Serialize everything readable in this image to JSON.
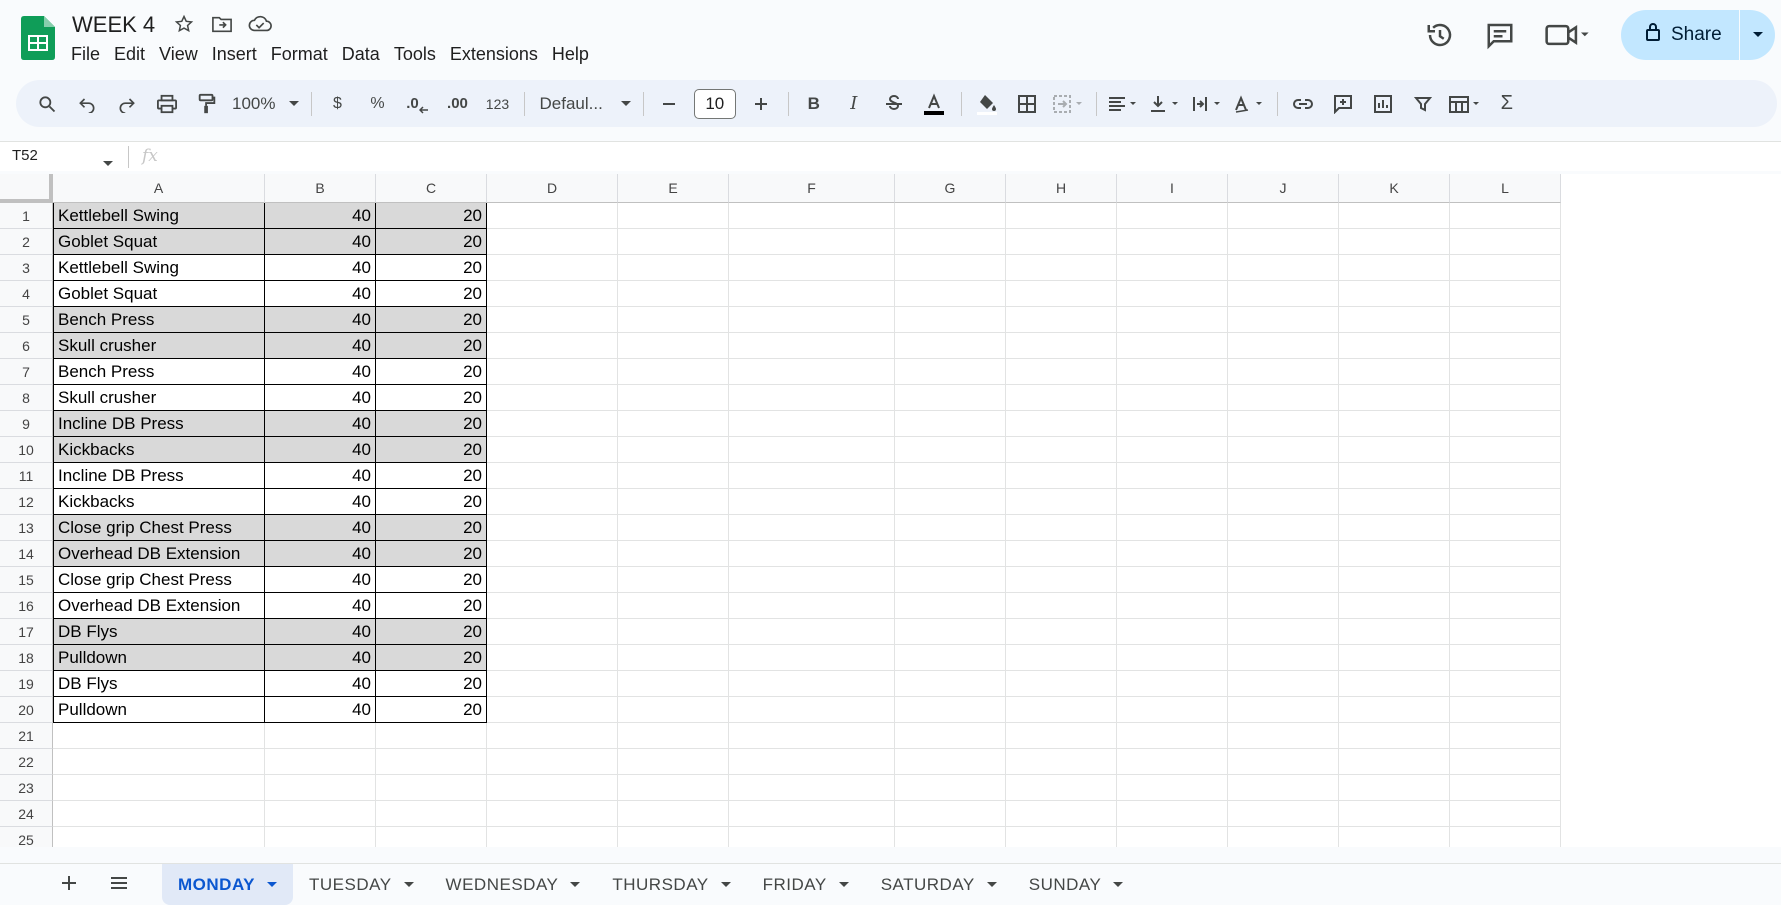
{
  "doc": {
    "title": "WEEK 4"
  },
  "menu": [
    "File",
    "Edit",
    "View",
    "Insert",
    "Format",
    "Data",
    "Tools",
    "Extensions",
    "Help"
  ],
  "share": {
    "label": "Share"
  },
  "toolbar": {
    "zoom": "100%",
    "currency": "$",
    "percent": "%",
    "dec_decrease": ".0",
    "dec_increase": ".00",
    "number_format": "123",
    "font": "Defaul...",
    "font_size": "10"
  },
  "namebox": {
    "value": "T52"
  },
  "formula": {
    "fx": "fx",
    "value": ""
  },
  "columns": [
    "A",
    "B",
    "C",
    "D",
    "E",
    "F",
    "G",
    "H",
    "I",
    "J",
    "K",
    "L"
  ],
  "rows": [
    {
      "n": "1",
      "a": "Kettlebell Swing",
      "b": "40",
      "c": "20",
      "shaded": true
    },
    {
      "n": "2",
      "a": "Goblet Squat",
      "b": "40",
      "c": "20",
      "shaded": true
    },
    {
      "n": "3",
      "a": "Kettlebell Swing",
      "b": "40",
      "c": "20",
      "shaded": false
    },
    {
      "n": "4",
      "a": "Goblet Squat",
      "b": "40",
      "c": "20",
      "shaded": false
    },
    {
      "n": "5",
      "a": "Bench Press",
      "b": "40",
      "c": "20",
      "shaded": true
    },
    {
      "n": "6",
      "a": "Skull crusher",
      "b": "40",
      "c": "20",
      "shaded": true
    },
    {
      "n": "7",
      "a": "Bench Press",
      "b": "40",
      "c": "20",
      "shaded": false
    },
    {
      "n": "8",
      "a": "Skull crusher",
      "b": "40",
      "c": "20",
      "shaded": false
    },
    {
      "n": "9",
      "a": "Incline DB Press",
      "b": "40",
      "c": "20",
      "shaded": true
    },
    {
      "n": "10",
      "a": "Kickbacks",
      "b": "40",
      "c": "20",
      "shaded": true
    },
    {
      "n": "11",
      "a": "Incline DB Press",
      "b": "40",
      "c": "20",
      "shaded": false
    },
    {
      "n": "12",
      "a": "Kickbacks",
      "b": "40",
      "c": "20",
      "shaded": false
    },
    {
      "n": "13",
      "a": "Close grip Chest Press",
      "b": "40",
      "c": "20",
      "shaded": true
    },
    {
      "n": "14",
      "a": "Overhead DB Extension",
      "b": "40",
      "c": "20",
      "shaded": true
    },
    {
      "n": "15",
      "a": "Close grip Chest Press",
      "b": "40",
      "c": "20",
      "shaded": false
    },
    {
      "n": "16",
      "a": "Overhead DB Extension",
      "b": "40",
      "c": "20",
      "shaded": false
    },
    {
      "n": "17",
      "a": "DB Flys",
      "b": "40",
      "c": "20",
      "shaded": true
    },
    {
      "n": "18",
      "a": "Pulldown",
      "b": "40",
      "c": "20",
      "shaded": true
    },
    {
      "n": "19",
      "a": "DB Flys",
      "b": "40",
      "c": "20",
      "shaded": false
    },
    {
      "n": "20",
      "a": "Pulldown",
      "b": "40",
      "c": "20",
      "shaded": false
    },
    {
      "n": "21",
      "a": "",
      "b": "",
      "c": "",
      "shaded": false
    },
    {
      "n": "22",
      "a": "",
      "b": "",
      "c": "",
      "shaded": false
    },
    {
      "n": "23",
      "a": "",
      "b": "",
      "c": "",
      "shaded": false
    },
    {
      "n": "24",
      "a": "",
      "b": "",
      "c": "",
      "shaded": false
    },
    {
      "n": "25",
      "a": "",
      "b": "",
      "c": "",
      "shaded": false
    }
  ],
  "sheets": [
    {
      "label": "MONDAY",
      "active": true
    },
    {
      "label": "TUESDAY",
      "active": false
    },
    {
      "label": "WEDNESDAY",
      "active": false
    },
    {
      "label": "THURSDAY",
      "active": false
    },
    {
      "label": "FRIDAY",
      "active": false
    },
    {
      "label": "SATURDAY",
      "active": false
    },
    {
      "label": "SUNDAY",
      "active": false
    }
  ],
  "colors": {
    "accent": "#0b57d0",
    "share_bg": "#c2e7ff",
    "shade": "#d9d9d9",
    "logo": "#0f9d58"
  }
}
